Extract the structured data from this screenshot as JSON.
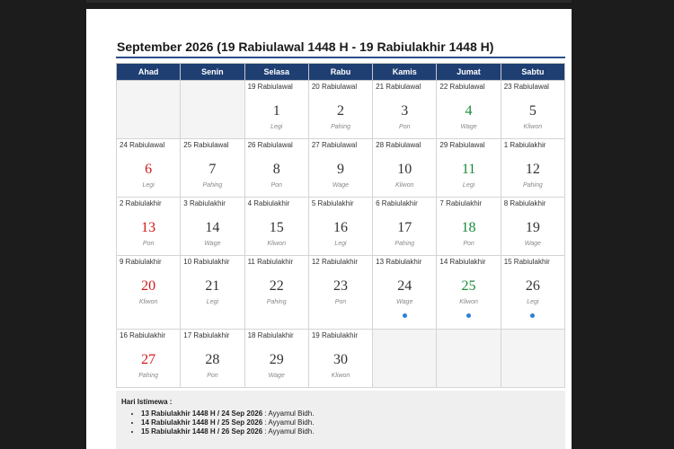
{
  "title": "September 2026 (19 Rabiulawal 1448 H - 19 Rabiulakhir 1448 H)",
  "weekdays": [
    "Ahad",
    "Senin",
    "Selasa",
    "Rabu",
    "Kamis",
    "Jumat",
    "Sabtu"
  ],
  "colors": {
    "header": "#1f3f73",
    "sunday": "#d0191b",
    "friday": "#1a8a3a",
    "event_dot": "#2f7fd8"
  },
  "weeks": [
    [
      null,
      null,
      {
        "hijri": "19 Rabiulawal",
        "day": "1",
        "pasaran": "Legi"
      },
      {
        "hijri": "20 Rabiulawal",
        "day": "2",
        "pasaran": "Pahing"
      },
      {
        "hijri": "21 Rabiulawal",
        "day": "3",
        "pasaran": "Pon"
      },
      {
        "hijri": "22 Rabiulawal",
        "day": "4",
        "pasaran": "Wage"
      },
      {
        "hijri": "23 Rabiulawal",
        "day": "5",
        "pasaran": "Kliwon"
      }
    ],
    [
      {
        "hijri": "24 Rabiulawal",
        "day": "6",
        "pasaran": "Legi"
      },
      {
        "hijri": "25 Rabiulawal",
        "day": "7",
        "pasaran": "Pahing"
      },
      {
        "hijri": "26 Rabiulawal",
        "day": "8",
        "pasaran": "Pon"
      },
      {
        "hijri": "27 Rabiulawal",
        "day": "9",
        "pasaran": "Wage"
      },
      {
        "hijri": "28 Rabiulawal",
        "day": "10",
        "pasaran": "Kliwon"
      },
      {
        "hijri": "29 Rabiulawal",
        "day": "11",
        "pasaran": "Legi"
      },
      {
        "hijri": "1 Rabiulakhir",
        "day": "12",
        "pasaran": "Pahing"
      }
    ],
    [
      {
        "hijri": "2 Rabiulakhir",
        "day": "13",
        "pasaran": "Pon"
      },
      {
        "hijri": "3 Rabiulakhir",
        "day": "14",
        "pasaran": "Wage"
      },
      {
        "hijri": "4 Rabiulakhir",
        "day": "15",
        "pasaran": "Kliwon"
      },
      {
        "hijri": "5 Rabiulakhir",
        "day": "16",
        "pasaran": "Legi"
      },
      {
        "hijri": "6 Rabiulakhir",
        "day": "17",
        "pasaran": "Pahing"
      },
      {
        "hijri": "7 Rabiulakhir",
        "day": "18",
        "pasaran": "Pon"
      },
      {
        "hijri": "8 Rabiulakhir",
        "day": "19",
        "pasaran": "Wage"
      }
    ],
    [
      {
        "hijri": "9 Rabiulakhir",
        "day": "20",
        "pasaran": "Kliwon"
      },
      {
        "hijri": "10 Rabiulakhir",
        "day": "21",
        "pasaran": "Legi"
      },
      {
        "hijri": "11 Rabiulakhir",
        "day": "22",
        "pasaran": "Pahing"
      },
      {
        "hijri": "12 Rabiulakhir",
        "day": "23",
        "pasaran": "Pon"
      },
      {
        "hijri": "13 Rabiulakhir",
        "day": "24",
        "pasaran": "Wage",
        "event": true
      },
      {
        "hijri": "14 Rabiulakhir",
        "day": "25",
        "pasaran": "Kliwon",
        "event": true
      },
      {
        "hijri": "15 Rabiulakhir",
        "day": "26",
        "pasaran": "Legi",
        "event": true
      }
    ],
    [
      {
        "hijri": "16 Rabiulakhir",
        "day": "27",
        "pasaran": "Pahing"
      },
      {
        "hijri": "17 Rabiulakhir",
        "day": "28",
        "pasaran": "Pon"
      },
      {
        "hijri": "18 Rabiulakhir",
        "day": "29",
        "pasaran": "Wage"
      },
      {
        "hijri": "19 Rabiulakhir",
        "day": "30",
        "pasaran": "Kliwon"
      },
      null,
      null,
      null
    ]
  ],
  "special": {
    "title": "Hari Istimewa :",
    "items": [
      {
        "date": "13 Rabiulakhir 1448 H / 24 Sep 2026",
        "desc": ": Ayyamul Bidh."
      },
      {
        "date": "14 Rabiulakhir 1448 H / 25 Sep 2026",
        "desc": ": Ayyamul Bidh."
      },
      {
        "date": "15 Rabiulakhir 1448 H / 26 Sep 2026",
        "desc": ": Ayyamul Bidh."
      }
    ]
  }
}
